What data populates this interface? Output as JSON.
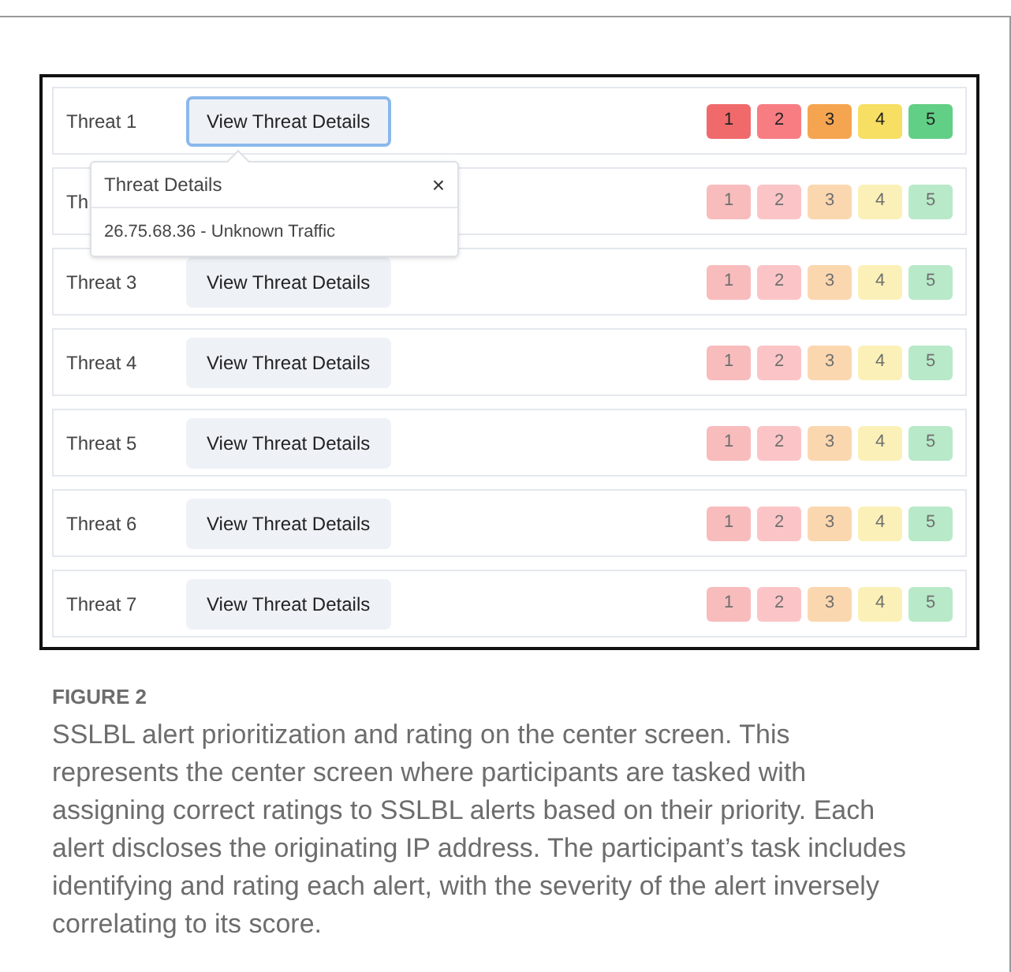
{
  "threats": [
    {
      "label": "Threat 1",
      "button": "View Threat Details",
      "focused": true,
      "active": true,
      "ratings": [
        {
          "label": "1",
          "color": "#f06a6c"
        },
        {
          "label": "2",
          "color": "#f77d82"
        },
        {
          "label": "3",
          "color": "#f5a550"
        },
        {
          "label": "4",
          "color": "#f6df62"
        },
        {
          "label": "5",
          "color": "#62cf86"
        }
      ]
    },
    {
      "label": "Th",
      "active": false,
      "ratings": [
        {
          "label": "1",
          "color": "#f8bcbd"
        },
        {
          "label": "2",
          "color": "#fbc5c7"
        },
        {
          "label": "3",
          "color": "#fbd7b0"
        },
        {
          "label": "4",
          "color": "#fbf1b8"
        },
        {
          "label": "5",
          "color": "#b8e9c9"
        }
      ]
    },
    {
      "label": "Threat 3",
      "button": "View Threat Details",
      "focused": false,
      "active": false,
      "ratings": [
        {
          "label": "1",
          "color": "#f8bcbd"
        },
        {
          "label": "2",
          "color": "#fbc5c7"
        },
        {
          "label": "3",
          "color": "#fbd7b0"
        },
        {
          "label": "4",
          "color": "#fbf1b8"
        },
        {
          "label": "5",
          "color": "#b8e9c9"
        }
      ]
    },
    {
      "label": "Threat 4",
      "button": "View Threat Details",
      "focused": false,
      "active": false,
      "ratings": [
        {
          "label": "1",
          "color": "#f8bcbd"
        },
        {
          "label": "2",
          "color": "#fbc5c7"
        },
        {
          "label": "3",
          "color": "#fbd7b0"
        },
        {
          "label": "4",
          "color": "#fbf1b8"
        },
        {
          "label": "5",
          "color": "#b8e9c9"
        }
      ]
    },
    {
      "label": "Threat 5",
      "button": "View Threat Details",
      "focused": false,
      "active": false,
      "ratings": [
        {
          "label": "1",
          "color": "#f8bcbd"
        },
        {
          "label": "2",
          "color": "#fbc5c7"
        },
        {
          "label": "3",
          "color": "#fbd7b0"
        },
        {
          "label": "4",
          "color": "#fbf1b8"
        },
        {
          "label": "5",
          "color": "#b8e9c9"
        }
      ]
    },
    {
      "label": "Threat 6",
      "button": "View Threat Details",
      "focused": false,
      "active": false,
      "ratings": [
        {
          "label": "1",
          "color": "#f8bcbd"
        },
        {
          "label": "2",
          "color": "#fbc5c7"
        },
        {
          "label": "3",
          "color": "#fbd7b0"
        },
        {
          "label": "4",
          "color": "#fbf1b8"
        },
        {
          "label": "5",
          "color": "#b8e9c9"
        }
      ]
    },
    {
      "label": "Threat 7",
      "button": "View Threat Details",
      "focused": false,
      "active": false,
      "ratings": [
        {
          "label": "1",
          "color": "#f8bcbd"
        },
        {
          "label": "2",
          "color": "#fbc5c7"
        },
        {
          "label": "3",
          "color": "#fbd7b0"
        },
        {
          "label": "4",
          "color": "#fbf1b8"
        },
        {
          "label": "5",
          "color": "#b8e9c9"
        }
      ]
    }
  ],
  "popover": {
    "title": "Threat Details",
    "close": "×",
    "body": "26.75.68.36 - Unknown Traffic"
  },
  "caption": {
    "label": "FIGURE 2",
    "text": "SSLBL alert prioritization and rating on the center screen. This represents the center screen where participants are tasked with assigning correct ratings to SSLBL alerts based on their priority. Each alert discloses the originating IP address. The participant’s task includes identifying and rating each alert, with the severity of the alert inversely correlating to its score."
  }
}
